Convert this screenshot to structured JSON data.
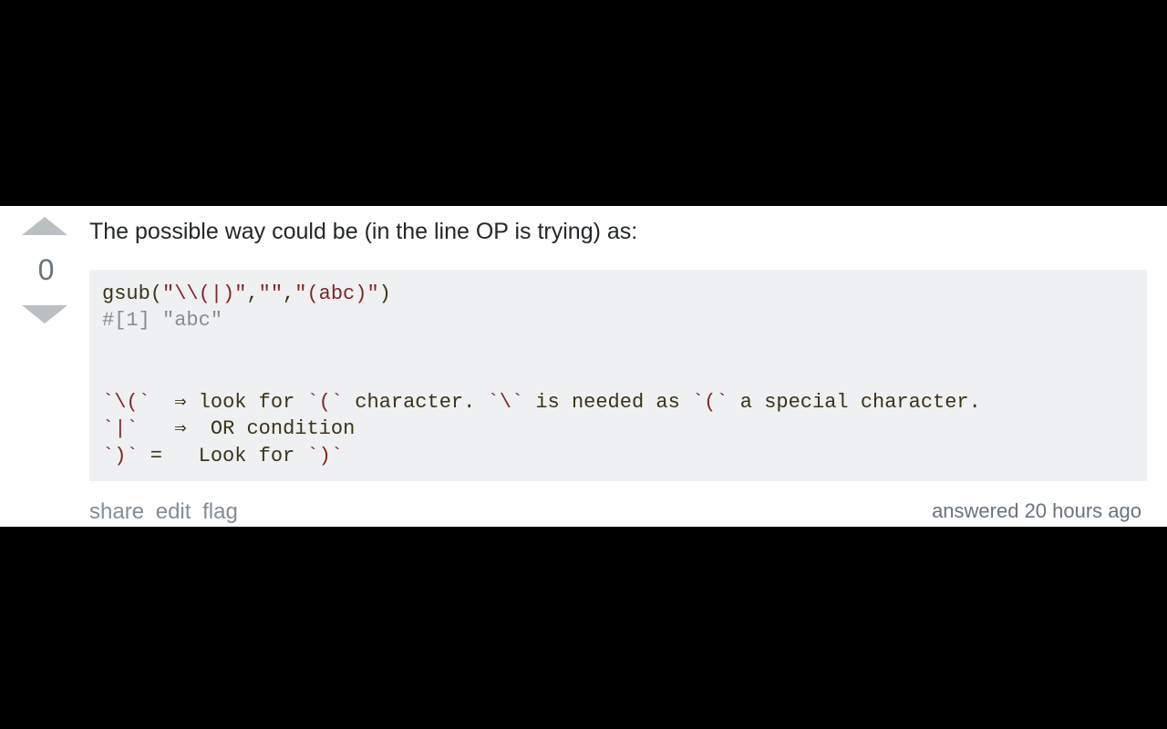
{
  "vote": {
    "count": "0"
  },
  "answer": {
    "intro": "The possible way could be (in the line OP is trying) as:",
    "code": {
      "line1": "gsub(",
      "str1": "\"\\\\(|)\"",
      "sep12": ",",
      "str2": "\"\"",
      "sep23": ",",
      "str3": "\"(abc)\"",
      "line1_close": ")",
      "comment": "#[1] \"abc\"",
      "blank": "",
      "exp1_a": "`\\(`",
      "exp1_b": "  ⇒ look for ",
      "exp1_c": "`(`",
      "exp1_d": " character. ",
      "exp1_e": "`\\`",
      "exp1_f": " is needed as ",
      "exp1_g": "`(`",
      "exp1_h": " a special character.",
      "exp2_a": "`|`",
      "exp2_b": "   ⇒  OR condition",
      "exp3_a": "`)`",
      "exp3_b": " =   Look for ",
      "exp3_c": "`)`"
    }
  },
  "actions": {
    "share": "share",
    "edit": "edit",
    "flag": "flag",
    "answered": "answered 20 hours ago"
  }
}
